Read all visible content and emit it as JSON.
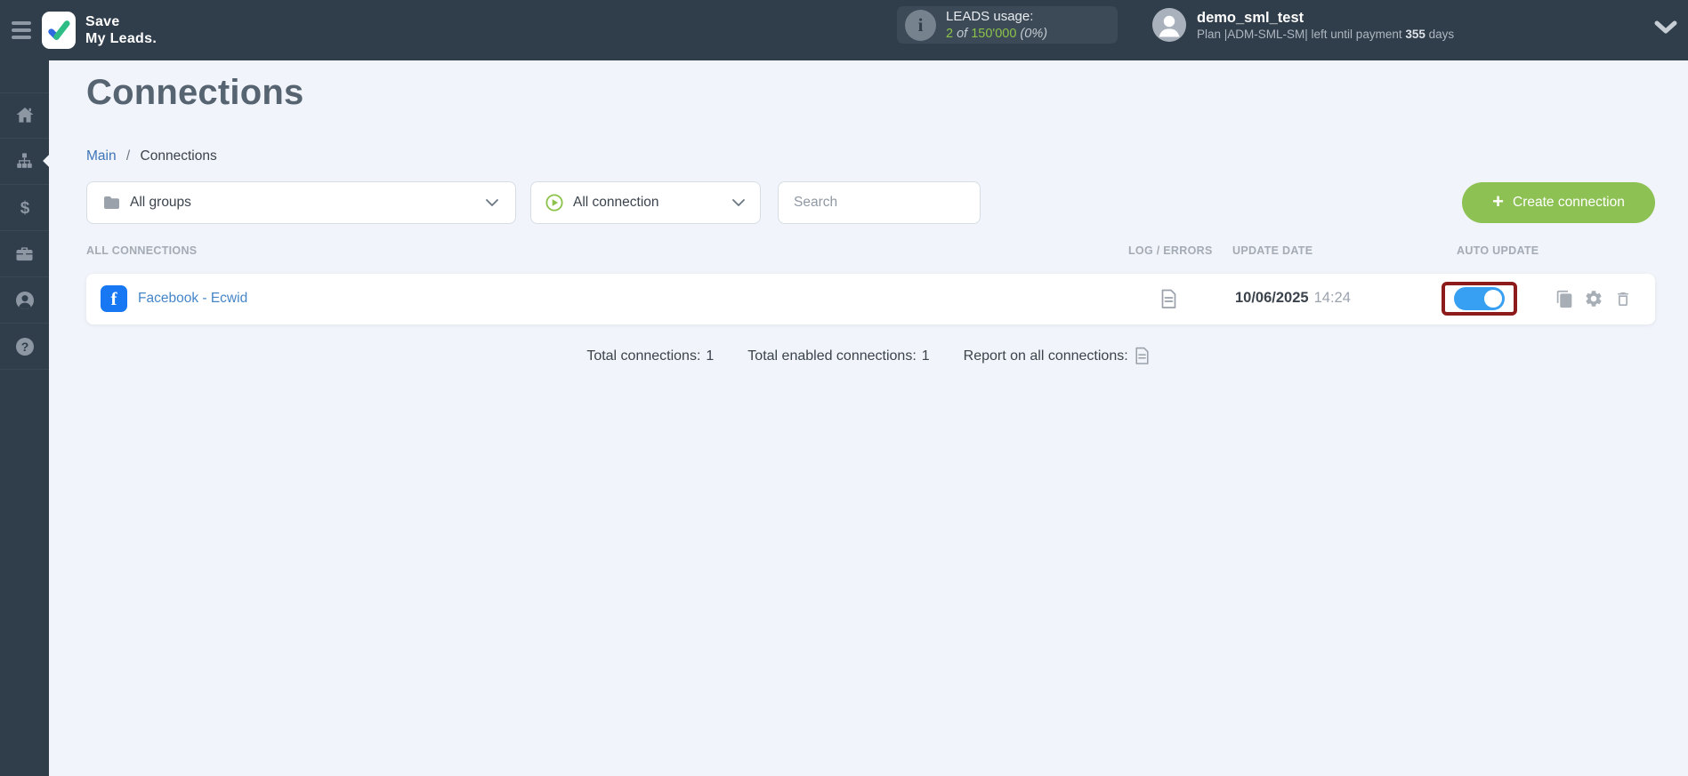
{
  "topbar": {
    "brand_line1": "Save",
    "brand_line2": "My Leads.",
    "leads_usage": {
      "label": "LEADS usage:",
      "used": "2",
      "of_word": "of",
      "total": "150'000",
      "percent": "(0%)"
    },
    "user": {
      "name": "demo_sml_test",
      "plan_prefix": "Plan |ADM-SML-SM| left until payment ",
      "days_value": "355",
      "days_suffix": " days"
    }
  },
  "sidebar": {
    "items": [
      {
        "name": "home"
      },
      {
        "name": "connections"
      },
      {
        "name": "payments"
      },
      {
        "name": "services"
      },
      {
        "name": "profile"
      },
      {
        "name": "help"
      }
    ]
  },
  "page": {
    "title": "Connections",
    "breadcrumb_main": "Main",
    "breadcrumb_sep": "/",
    "breadcrumb_current": "Connections"
  },
  "filters": {
    "groups_dropdown_value": "All groups",
    "connection_dropdown_value": "All connection",
    "search_placeholder": "Search",
    "create_button_plus": "+",
    "create_button_label": "Create connection"
  },
  "table": {
    "headers": [
      "ALL CONNECTIONS",
      "LOG / ERRORS",
      "UPDATE DATE",
      "AUTO UPDATE"
    ],
    "rows": [
      {
        "name": "Facebook - Ecwid",
        "source_icon": "facebook-icon",
        "source_letter": "f",
        "update_date": "10/06/2025",
        "update_time": "14:24",
        "auto_update_enabled": true
      }
    ]
  },
  "footer": {
    "total_label": "Total connections:",
    "total_value": "1",
    "enabled_label": "Total enabled connections:",
    "enabled_value": "1",
    "report_label": "Report on all connections:"
  },
  "colors": {
    "topbar_bg": "#303d4a",
    "accent_green": "#8dc153",
    "usage_green": "#8bc34a",
    "toggle_blue": "#38a0f2",
    "highlight_red": "#8e1b1b",
    "facebook_blue": "#1877f2",
    "link_blue": "#4486c8",
    "content_bg": "#f1f4fa"
  }
}
